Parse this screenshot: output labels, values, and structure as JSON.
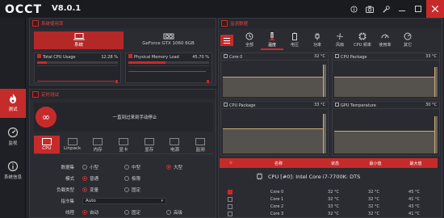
{
  "app": {
    "logo_text": "OCCT",
    "version": "V8.0.1"
  },
  "titlebar_icons": [
    "info-icon",
    "camera-icon",
    "wrench-icon",
    "minimize-icon",
    "maximize-icon",
    "close-icon"
  ],
  "nav": [
    {
      "label": "测试",
      "icon": "flame-icon",
      "active": true
    },
    {
      "label": "监视",
      "icon": "gauge-icon",
      "active": false
    },
    {
      "label": "系统信息",
      "icon": "info-circle-icon",
      "active": false
    }
  ],
  "system_usage": {
    "title": "系统使用率",
    "tabs": [
      {
        "label": "系统",
        "active": true
      },
      {
        "label": "GeForce GTX 1060 6GB",
        "active": false
      }
    ],
    "meters": [
      {
        "label": "Total CPU Usage",
        "value_text": "12.28 %",
        "percent": 12.28
      },
      {
        "label": "Physical Memory Load",
        "value_text": "45.70 %",
        "percent": 45.7
      }
    ]
  },
  "timed_test": {
    "title": "定时测试",
    "message": "一直到过来到手动停止",
    "circle_symbol": "∞",
    "tabs": [
      {
        "label": "CPU",
        "active": true
      },
      {
        "label": "Linpack",
        "active": false
      },
      {
        "label": "内存",
        "active": false
      },
      {
        "label": "显卡",
        "active": false
      },
      {
        "label": "显存",
        "active": false
      },
      {
        "label": "电源",
        "active": false
      },
      {
        "label": "监测",
        "active": false
      }
    ],
    "options": [
      {
        "label": "数据集",
        "type": "radio",
        "choices": [
          "小型",
          "中型",
          "大型"
        ],
        "selected": 2
      },
      {
        "label": "模式",
        "type": "radio",
        "choices": [
          "普通",
          "极限"
        ],
        "selected": 0
      },
      {
        "label": "负载类型",
        "type": "radio",
        "choices": [
          "变量",
          "固定"
        ],
        "selected": 0
      },
      {
        "label": "指令集",
        "type": "select",
        "value": "Auto"
      },
      {
        "label": "线程",
        "type": "radio",
        "choices": [
          "自动",
          "固定",
          "高级"
        ],
        "selected": 0
      }
    ]
  },
  "monitoring": {
    "title": "监测数据",
    "tabs": [
      {
        "label": "全部",
        "icon": "clock-icon",
        "active": false
      },
      {
        "label": "温度",
        "icon": "thermometer-icon",
        "active": true
      },
      {
        "label": "电压",
        "icon": "battery-icon",
        "active": false
      },
      {
        "label": "功率",
        "icon": "plug-icon",
        "active": false
      },
      {
        "label": "风扇",
        "icon": "fan-icon",
        "active": false
      },
      {
        "label": "CPU 频率",
        "icon": "chip-icon",
        "active": false
      },
      {
        "label": "使用率",
        "icon": "gauge-icon",
        "active": false
      },
      {
        "label": "其它",
        "icon": "dial-icon",
        "active": false
      }
    ],
    "graphs": [
      {
        "label": "Core 0",
        "value": "32 °C",
        "level": 0.55,
        "spike": 0.9
      },
      {
        "label": "CPU Package",
        "value": "33 °C",
        "level": 0.55,
        "spike": 0.85
      },
      {
        "label": "CPU Package",
        "value": "33 °C",
        "level": 0.55,
        "spike": 0.9
      },
      {
        "label": "GPU Temperature",
        "value": "30 °C",
        "level": 0.5,
        "spike": 0.85
      }
    ],
    "sensor_columns": [
      "名称",
      "状态",
      "最小值",
      "最大值"
    ],
    "sensor_group": "CPU [#0]: Intel Core i7-7700K: DTS",
    "sensors": [
      {
        "name": "Core 0",
        "value": "32 °C",
        "min": "32 °C",
        "max": "45 °C",
        "checked": true
      },
      {
        "name": "Core 1",
        "value": "32 °C",
        "min": "32 °C",
        "max": "41 °C",
        "checked": false
      },
      {
        "name": "Core 2",
        "value": "33 °C",
        "min": "32 °C",
        "max": "43 °C",
        "checked": false
      },
      {
        "name": "Core 3",
        "value": "32 °C",
        "min": "32 °C",
        "max": "41 °C",
        "checked": false
      }
    ]
  },
  "colors": {
    "accent": "#c62b2b",
    "background": "#23242a",
    "panel": "#2b2c32"
  }
}
